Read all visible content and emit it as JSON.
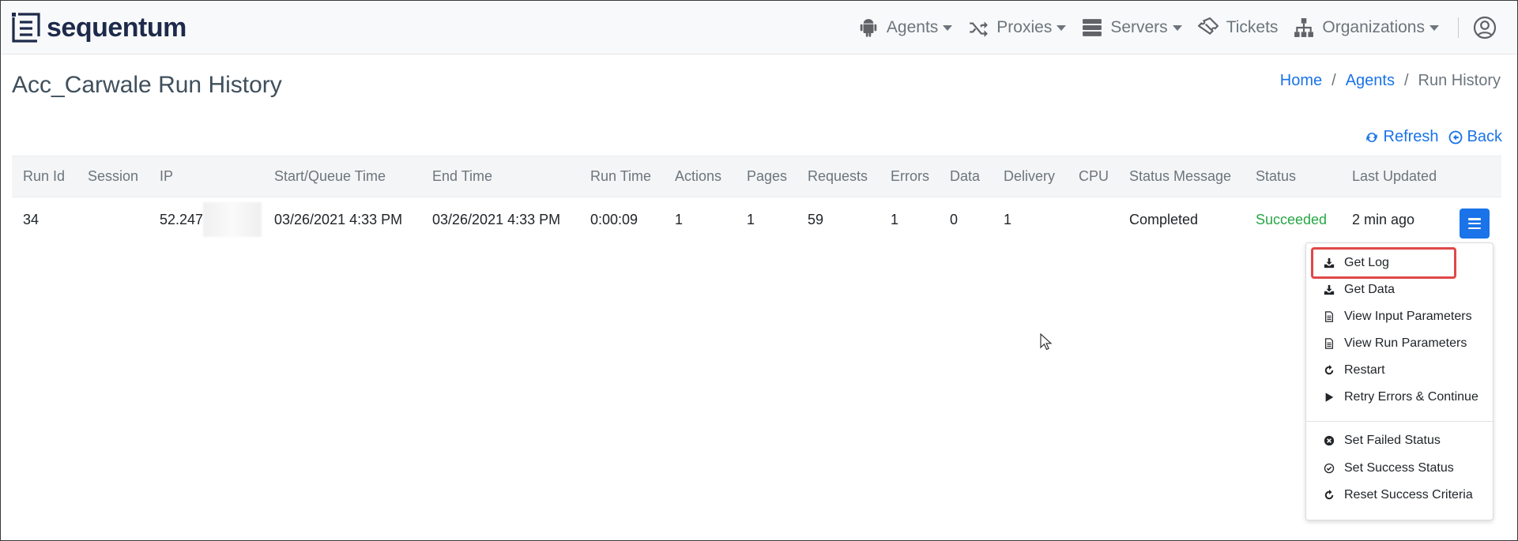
{
  "brand": {
    "name": "sequentum"
  },
  "nav": {
    "items": [
      {
        "label": "Agents",
        "icon": "android-icon",
        "dropdown": true
      },
      {
        "label": "Proxies",
        "icon": "shuffle-icon",
        "dropdown": true
      },
      {
        "label": "Servers",
        "icon": "server-icon",
        "dropdown": true
      },
      {
        "label": "Tickets",
        "icon": "ticket-icon",
        "dropdown": false
      },
      {
        "label": "Organizations",
        "icon": "sitemap-icon",
        "dropdown": true
      }
    ],
    "user_icon": "user-circle-icon"
  },
  "page": {
    "title": "Acc_Carwale Run History"
  },
  "breadcrumb": {
    "home": "Home",
    "agents": "Agents",
    "current": "Run History",
    "separator": "/"
  },
  "actions": {
    "refresh": "Refresh",
    "back": "Back"
  },
  "table": {
    "headers": {
      "run_id": "Run Id",
      "session": "Session",
      "ip": "IP",
      "start": "Start/Queue Time",
      "end": "End Time",
      "run_time": "Run Time",
      "actions": "Actions",
      "pages": "Pages",
      "requests": "Requests",
      "errors": "Errors",
      "data": "Data",
      "delivery": "Delivery",
      "cpu": "CPU",
      "status_message": "Status Message",
      "status": "Status",
      "last_updated": "Last Updated"
    },
    "rows": [
      {
        "run_id": "34",
        "session": "",
        "ip": "52.247",
        "start": "03/26/2021 4:33 PM",
        "end": "03/26/2021 4:33 PM",
        "run_time": "0:00:09",
        "actions": "1",
        "pages": "1",
        "requests": "59",
        "errors": "1",
        "data": "0",
        "delivery": "1",
        "cpu": "",
        "status_message": "Completed",
        "status": "Succeeded",
        "last_updated": "2 min ago"
      }
    ]
  },
  "row_menu": {
    "items": [
      {
        "label": "Get Log",
        "icon": "download-icon"
      },
      {
        "label": "Get Data",
        "icon": "download-icon"
      },
      {
        "label": "View Input Parameters",
        "icon": "file-icon"
      },
      {
        "label": "View Run Parameters",
        "icon": "file-icon"
      },
      {
        "label": "Restart",
        "icon": "redo-icon"
      },
      {
        "label": "Retry Errors & Continue",
        "icon": "play-icon"
      },
      {
        "label": "Set Failed Status",
        "icon": "times-circle-icon"
      },
      {
        "label": "Set Success Status",
        "icon": "check-circle-icon"
      },
      {
        "label": "Reset Success Criteria",
        "icon": "redo-icon"
      }
    ]
  },
  "colors": {
    "accent": "#1a73e8",
    "success": "#28a745",
    "highlight_border": "#e04848",
    "brand": "#1d2a4a"
  }
}
